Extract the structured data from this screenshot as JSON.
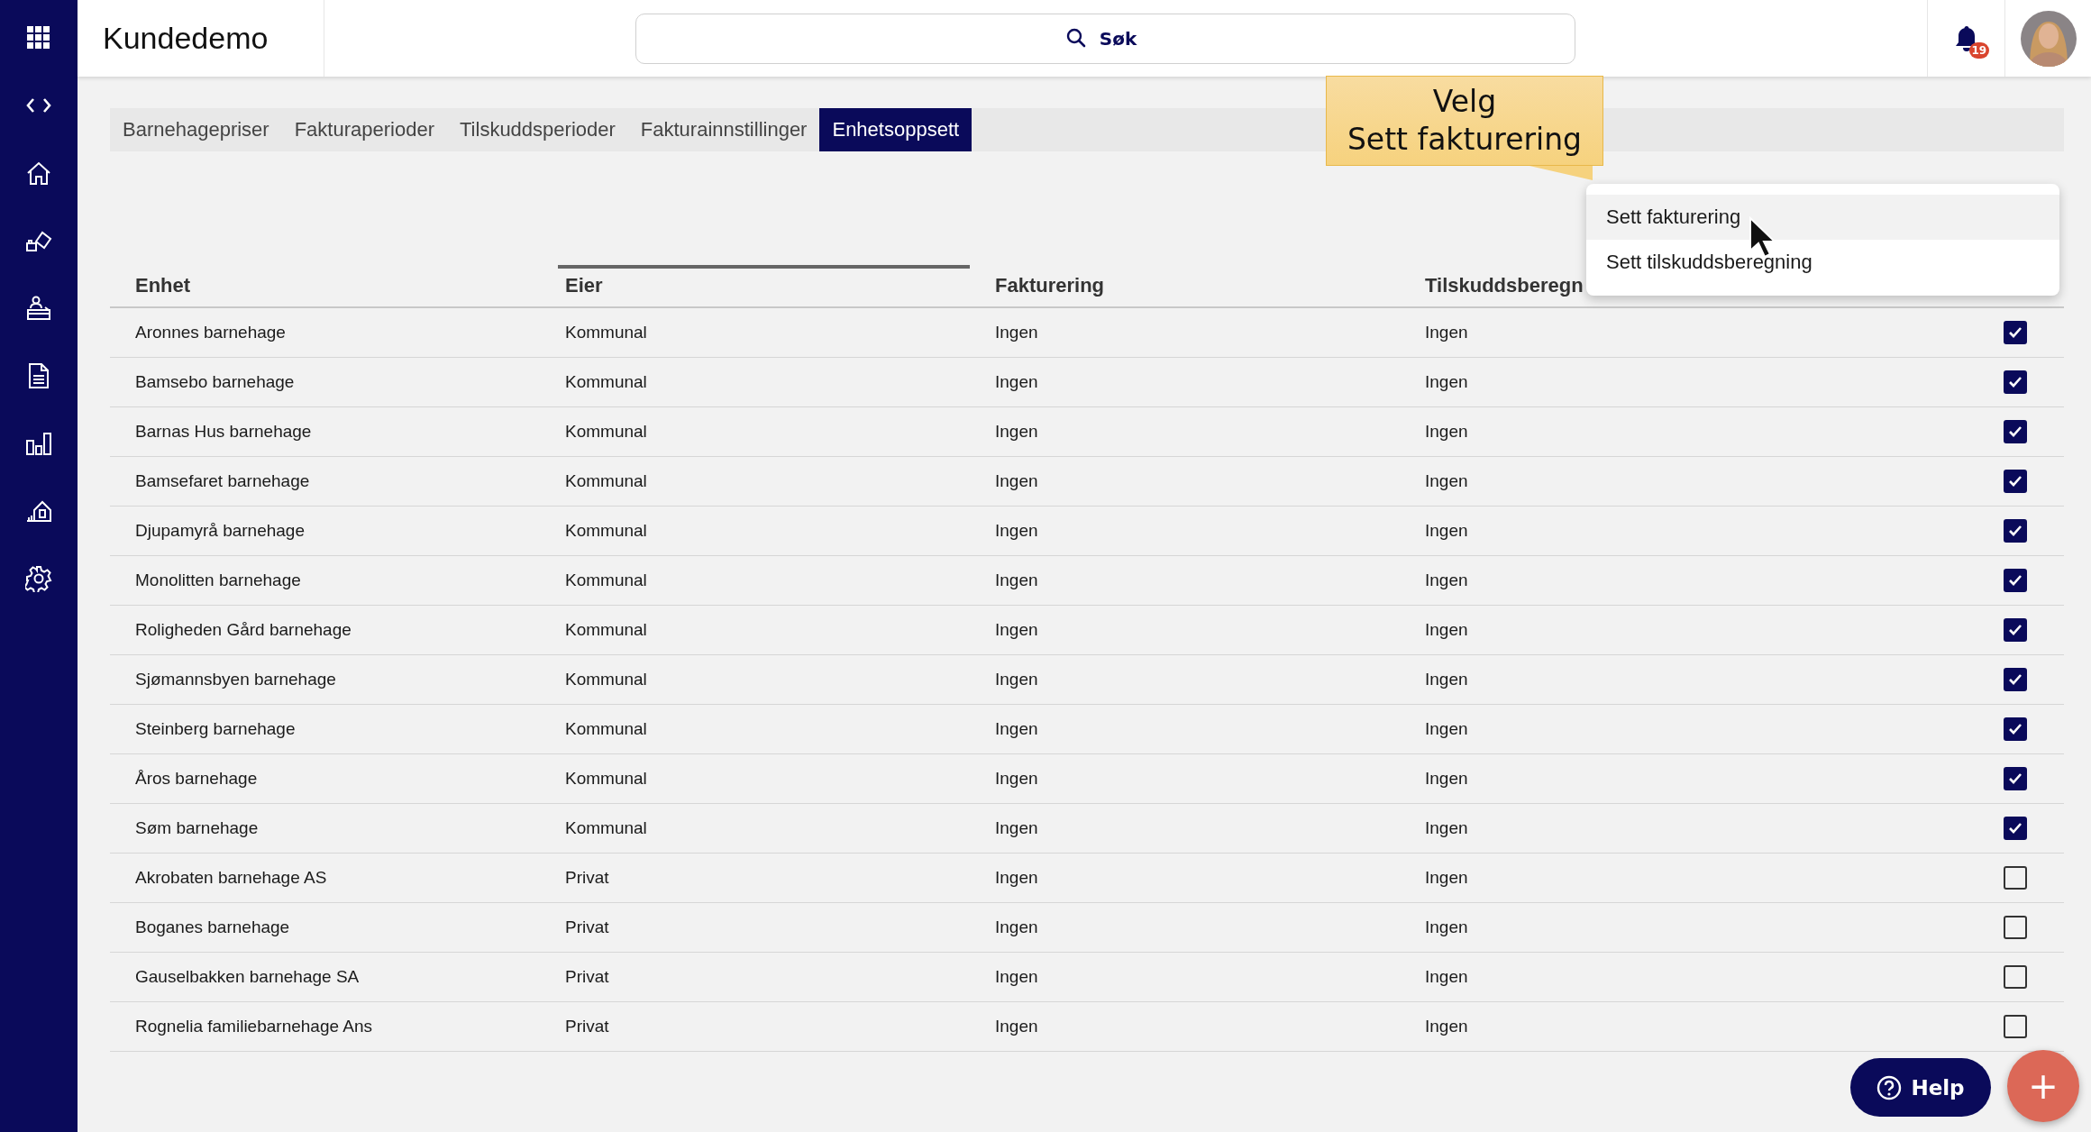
{
  "header": {
    "title": "Kundedemo",
    "search": {
      "placeholder": "Søk"
    },
    "notifications": {
      "count": "19"
    }
  },
  "sidebar": {
    "items": [
      {
        "kind": "grid"
      },
      {
        "kind": "code"
      },
      {
        "kind": "home"
      },
      {
        "kind": "blocks"
      },
      {
        "kind": "desk"
      },
      {
        "kind": "document"
      },
      {
        "kind": "chart"
      },
      {
        "kind": "house"
      },
      {
        "kind": "settings"
      }
    ]
  },
  "tabs": [
    {
      "label": "Barnehagepriser",
      "selected": false
    },
    {
      "label": "Fakturaperioder",
      "selected": false
    },
    {
      "label": "Tilskuddsperioder",
      "selected": false
    },
    {
      "label": "Fakturainnstillinger",
      "selected": false
    },
    {
      "label": "Enhetsoppsett",
      "selected": true
    }
  ],
  "tooltip": {
    "lines": [
      "Velg",
      "Sett fakturering"
    ]
  },
  "menu": {
    "items": [
      {
        "label": "Sett fakturering",
        "selected": true
      },
      {
        "label": "Sett tilskuddsberegning",
        "selected": false
      }
    ]
  },
  "table": {
    "columns": [
      {
        "label": "Enhet",
        "sorted": false
      },
      {
        "label": "Eier",
        "sorted": true
      },
      {
        "label": "Fakturering",
        "sorted": false
      },
      {
        "label": "Tilskuddsberegn",
        "sorted": false
      }
    ],
    "rows": [
      {
        "cells": [
          "Aronnes barnehage",
          "Kommunal",
          "Ingen",
          "Ingen"
        ],
        "checked": true
      },
      {
        "cells": [
          "Bamsebo barnehage",
          "Kommunal",
          "Ingen",
          "Ingen"
        ],
        "checked": true
      },
      {
        "cells": [
          "Barnas Hus barnehage",
          "Kommunal",
          "Ingen",
          "Ingen"
        ],
        "checked": true
      },
      {
        "cells": [
          "Bamsefaret barnehage",
          "Kommunal",
          "Ingen",
          "Ingen"
        ],
        "checked": true
      },
      {
        "cells": [
          "Djupamyrå barnehage",
          "Kommunal",
          "Ingen",
          "Ingen"
        ],
        "checked": true
      },
      {
        "cells": [
          "Monolitten barnehage",
          "Kommunal",
          "Ingen",
          "Ingen"
        ],
        "checked": true
      },
      {
        "cells": [
          "Roligheden Gård barnehage",
          "Kommunal",
          "Ingen",
          "Ingen"
        ],
        "checked": true
      },
      {
        "cells": [
          "Sjømannsbyen barnehage",
          "Kommunal",
          "Ingen",
          "Ingen"
        ],
        "checked": true
      },
      {
        "cells": [
          "Steinberg barnehage",
          "Kommunal",
          "Ingen",
          "Ingen"
        ],
        "checked": true
      },
      {
        "cells": [
          "Åros barnehage",
          "Kommunal",
          "Ingen",
          "Ingen"
        ],
        "checked": true
      },
      {
        "cells": [
          "Søm barnehage",
          "Kommunal",
          "Ingen",
          "Ingen"
        ],
        "checked": true
      },
      {
        "cells": [
          "Akrobaten barnehage AS",
          "Privat",
          "Ingen",
          "Ingen"
        ],
        "checked": false
      },
      {
        "cells": [
          "Boganes barnehage",
          "Privat",
          "Ingen",
          "Ingen"
        ],
        "checked": false
      },
      {
        "cells": [
          "Gauselbakken barnehage SA",
          "Privat",
          "Ingen",
          "Ingen"
        ],
        "checked": false
      },
      {
        "cells": [
          "Rognelia familiebarnehage Ans",
          "Privat",
          "Ingen",
          "Ingen"
        ],
        "checked": false
      }
    ]
  },
  "help_button": {
    "label": "Help"
  },
  "add_button": {
    "label": "+"
  }
}
